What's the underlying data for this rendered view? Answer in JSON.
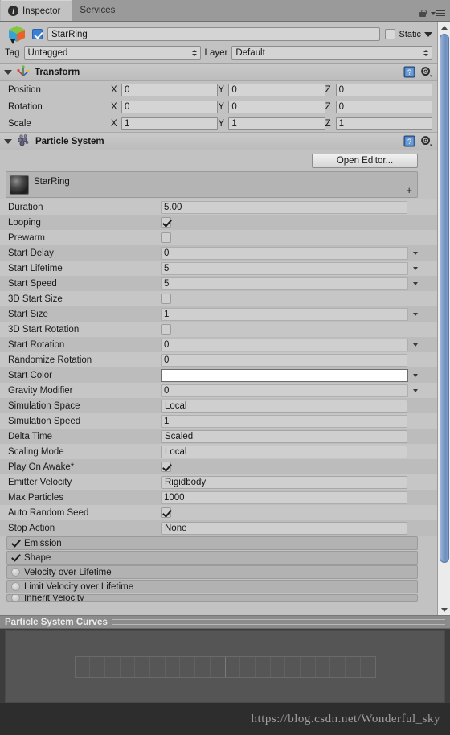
{
  "window": {
    "tabs": [
      {
        "label": "Inspector",
        "icon": "info-icon",
        "active": true
      },
      {
        "label": "Services",
        "icon": "",
        "active": false
      }
    ],
    "lock_icon": "lock-icon",
    "menu_icon": "hamburger-menu-icon"
  },
  "gameobject": {
    "icon": "cube-icon",
    "enabled": true,
    "name": "StarRing",
    "static_label": "Static",
    "static_checked": false,
    "tag_label": "Tag",
    "tag_value": "Untagged",
    "layer_label": "Layer",
    "layer_value": "Default"
  },
  "transform": {
    "title": "Transform",
    "icon": "transform-axis-icon",
    "help_icon": "help-book-icon",
    "gear_icon": "gear-icon",
    "rows": [
      {
        "label": "Position",
        "x": "0",
        "y": "0",
        "z": "0"
      },
      {
        "label": "Rotation",
        "x": "0",
        "y": "0",
        "z": "0"
      },
      {
        "label": "Scale",
        "x": "1",
        "y": "1",
        "z": "1"
      }
    ],
    "axis_labels": [
      "X",
      "Y",
      "Z"
    ]
  },
  "particle_system": {
    "title": "Particle System",
    "icon": "particle-system-icon",
    "help_icon": "help-book-icon",
    "gear_icon": "gear-icon",
    "open_editor_label": "Open Editor...",
    "emitter_name": "StarRing",
    "emitter_thumb": "material-sphere-thumbnail",
    "add_label": "+",
    "properties": [
      {
        "label": "Duration",
        "type": "field",
        "value": "5.00",
        "arrow": false,
        "shade": "lite"
      },
      {
        "label": "Looping",
        "type": "checkbox",
        "value": true,
        "arrow": false,
        "shade": "alt"
      },
      {
        "label": "Prewarm",
        "type": "checkbox",
        "value": false,
        "arrow": false,
        "shade": "lite"
      },
      {
        "label": "Start Delay",
        "type": "field",
        "value": "0",
        "arrow": true,
        "shade": "alt"
      },
      {
        "label": "Start Lifetime",
        "type": "field",
        "value": "5",
        "arrow": true,
        "shade": "lite"
      },
      {
        "label": "Start Speed",
        "type": "field",
        "value": "5",
        "arrow": true,
        "shade": "alt"
      },
      {
        "label": "3D Start Size",
        "type": "checkbox",
        "value": false,
        "arrow": false,
        "shade": "lite"
      },
      {
        "label": "Start Size",
        "type": "field",
        "value": "1",
        "arrow": true,
        "shade": "alt"
      },
      {
        "label": "3D Start Rotation",
        "type": "checkbox",
        "value": false,
        "arrow": false,
        "shade": "lite"
      },
      {
        "label": "Start Rotation",
        "type": "field",
        "value": "0",
        "arrow": true,
        "shade": "alt"
      },
      {
        "label": "Randomize Rotation",
        "type": "field",
        "value": "0",
        "arrow": false,
        "shade": "lite"
      },
      {
        "label": "Start Color",
        "type": "color",
        "value": "#ffffff",
        "arrow": true,
        "shade": "alt"
      },
      {
        "label": "Gravity Modifier",
        "type": "field",
        "value": "0",
        "arrow": true,
        "shade": "lite"
      },
      {
        "label": "Simulation Space",
        "type": "popup",
        "value": "Local",
        "arrow": false,
        "shade": "alt"
      },
      {
        "label": "Simulation Speed",
        "type": "field",
        "value": "1",
        "arrow": false,
        "shade": "lite"
      },
      {
        "label": "Delta Time",
        "type": "popup",
        "value": "Scaled",
        "arrow": false,
        "shade": "alt"
      },
      {
        "label": "Scaling Mode",
        "type": "popup",
        "value": "Local",
        "arrow": false,
        "shade": "lite"
      },
      {
        "label": "Play On Awake*",
        "type": "checkbox",
        "value": true,
        "arrow": false,
        "shade": "alt"
      },
      {
        "label": "Emitter Velocity",
        "type": "popup",
        "value": "Rigidbody",
        "arrow": false,
        "shade": "lite"
      },
      {
        "label": "Max Particles",
        "type": "field",
        "value": "1000",
        "arrow": false,
        "shade": "alt"
      },
      {
        "label": "Auto Random Seed",
        "type": "checkbox",
        "value": true,
        "arrow": false,
        "shade": "lite"
      },
      {
        "label": "Stop Action",
        "type": "popup",
        "value": "None",
        "arrow": false,
        "shade": "alt"
      }
    ],
    "modules": [
      {
        "label": "Emission",
        "state": "checked",
        "clipped": false
      },
      {
        "label": "Shape",
        "state": "checked",
        "clipped": false
      },
      {
        "label": "Velocity over Lifetime",
        "state": "disabled",
        "clipped": false
      },
      {
        "label": "Limit Velocity over Lifetime",
        "state": "disabled",
        "clipped": false
      },
      {
        "label": "Inherit Velocity",
        "state": "disabled",
        "clipped": true
      }
    ]
  },
  "curves_panel": {
    "title": "Particle System Curves",
    "grid_divisions": 20
  },
  "watermark": "https://blog.csdn.net/Wonderful_sky",
  "colors": {
    "panel_bg": "#c2c2c2",
    "chrome_bg": "#9a9a9a",
    "accent_blue": "#3d7fd4",
    "scrollbar_thumb": "#7d9cc8",
    "curves_bg": "#3c3c3c"
  }
}
